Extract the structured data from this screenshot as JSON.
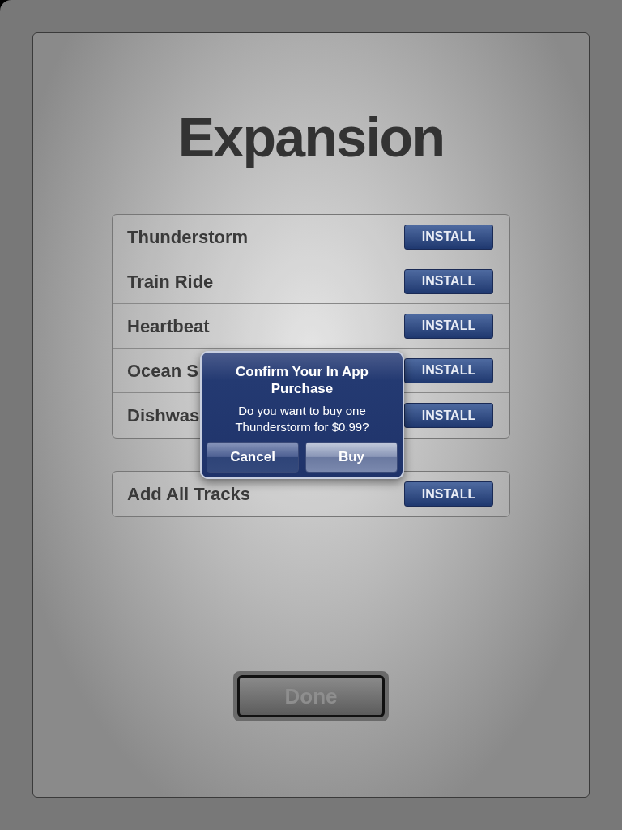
{
  "title": "Expansion",
  "tracks": [
    {
      "name": "Thunderstorm",
      "button": "INSTALL"
    },
    {
      "name": "Train Ride",
      "button": "INSTALL"
    },
    {
      "name": "Heartbeat",
      "button": "INSTALL"
    },
    {
      "name": "Ocean S",
      "button": "INSTALL"
    },
    {
      "name": "Dishwas",
      "button": "INSTALL"
    }
  ],
  "add_all": {
    "name": "Add All Tracks",
    "button": "INSTALL"
  },
  "done_button": {
    "label": "Done",
    "disabled": true
  },
  "dialog": {
    "title": "Confirm Your In App Purchase",
    "message": "Do you want to buy one Thunderstorm for $0.99?",
    "buttons": [
      "Cancel",
      "Buy"
    ]
  }
}
